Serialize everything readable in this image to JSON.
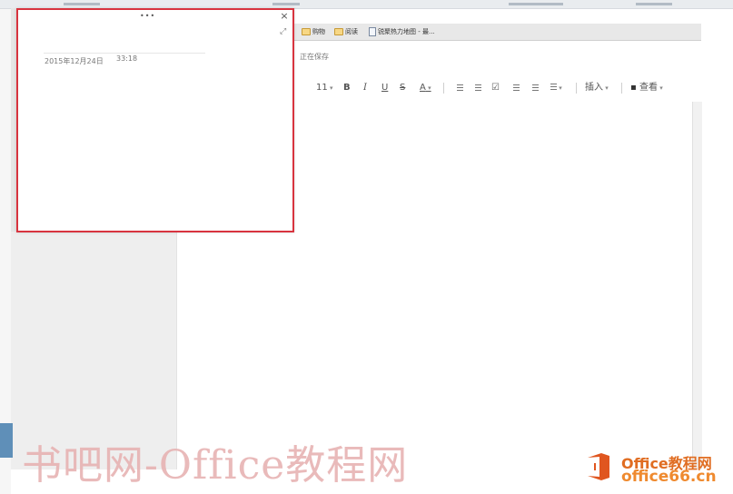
{
  "bookmarks": {
    "items": [
      {
        "label": "购物",
        "icon": "folder-icon"
      },
      {
        "label": "阅读",
        "icon": "folder-icon"
      },
      {
        "label": "锐聚热力地图 - 最...",
        "icon": "document-icon"
      }
    ]
  },
  "editor": {
    "status": "正在保存"
  },
  "toolbar": {
    "font_size": "11",
    "bold": "B",
    "italic": "I",
    "underline": "U",
    "strike": "S",
    "font_color": "A",
    "insert": "插入",
    "view": "查看"
  },
  "popup": {
    "dots": "•••",
    "close": "×",
    "expand": "⤢",
    "date": "2015年12月24日",
    "time": "33:18"
  },
  "watermark": {
    "text": "书吧网-Office教程网",
    "brand_line1": "Office教程网",
    "brand_line2": "office66.cn"
  },
  "colors": {
    "popup_border": "#d8343f",
    "watermark": "#e7b3b3",
    "brand_orange": "#e06d22"
  }
}
